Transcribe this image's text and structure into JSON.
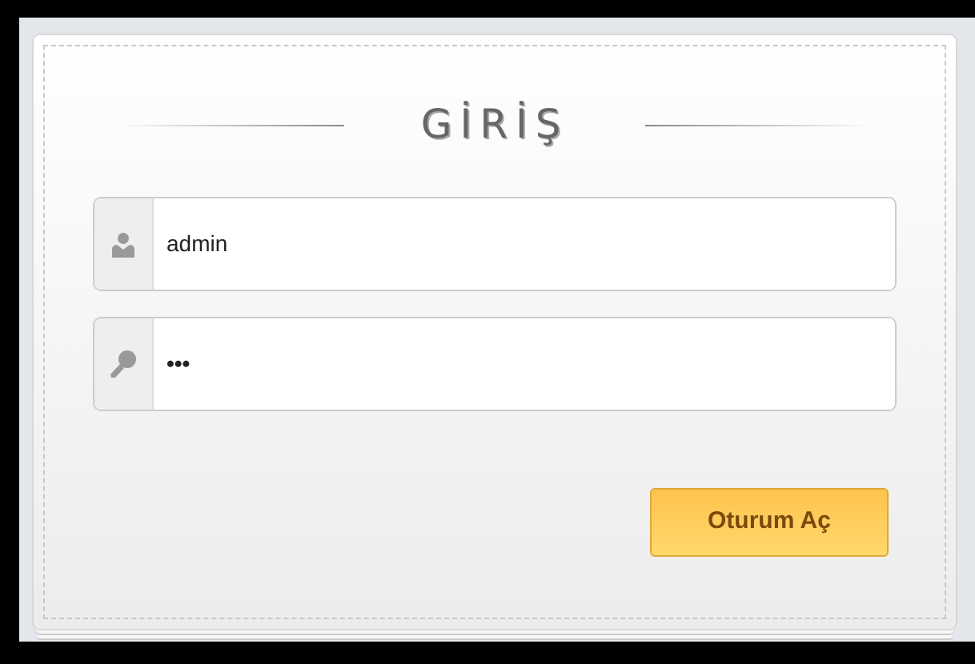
{
  "title": "GİRİŞ",
  "fields": [
    {
      "kind": "user",
      "value": "admin"
    },
    {
      "kind": "key",
      "value": "•••"
    }
  ],
  "button": "Oturum Aç"
}
